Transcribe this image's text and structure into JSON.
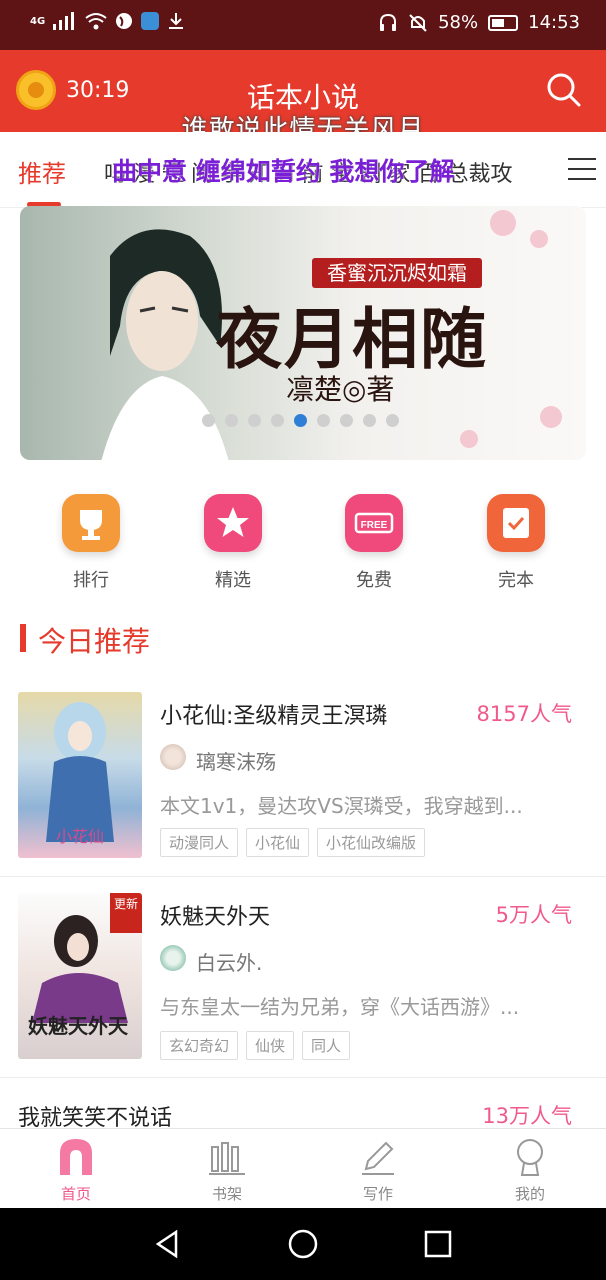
{
  "status_bar": {
    "network": "4G",
    "battery": "58%",
    "time": "14:53"
  },
  "header": {
    "timer": "30:19",
    "title": "话本小说",
    "overlay_subtitle": "谁敢说此情无关风月"
  },
  "tabs": {
    "active": "推荐",
    "row_text": "吗 漫 短 阅 学 知 H 前 宝 剧 家 百 总裁攻",
    "overlay_text": "曲中意 缠绵如誓约 我想你了解"
  },
  "banner": {
    "tagline": "香蜜沉沉烬如霜",
    "title": "夜月相随",
    "author": "凛楚◎著",
    "dot_count": 9,
    "active_dot": 5
  },
  "quick_links": [
    {
      "label": "排行",
      "icon": "trophy-icon",
      "color": "#f59a3a"
    },
    {
      "label": "精选",
      "icon": "star-icon",
      "color": "#f04a7c"
    },
    {
      "label": "免费",
      "icon": "free-icon",
      "color": "#f04a7c"
    },
    {
      "label": "完本",
      "icon": "check-icon",
      "color": "#f0663a"
    }
  ],
  "section": {
    "title": "今日推荐"
  },
  "books": [
    {
      "title": "小花仙:圣级精灵王溟璘",
      "popularity": "8157人气",
      "author": "璃寒沫殇",
      "blurb": "本文1v1，曼达攻VS溟璘受，我穿越到...",
      "tags": [
        "动漫同人",
        "小花仙",
        "小花仙改编版"
      ]
    },
    {
      "title": "妖魅天外天",
      "popularity": "5万人气",
      "author": "白云外.",
      "blurb": "与东皇太一结为兄弟，穿《大话西游》...",
      "tags": [
        "玄幻奇幻",
        "仙侠",
        "同人"
      ],
      "badge": "更新"
    },
    {
      "title": "我就笑笑不说话",
      "popularity": "13万人气"
    }
  ],
  "bottom_nav": [
    {
      "label": "首页",
      "icon": "home-icon",
      "active": true
    },
    {
      "label": "书架",
      "icon": "bookshelf-icon",
      "active": false
    },
    {
      "label": "写作",
      "icon": "pencil-icon",
      "active": false
    },
    {
      "label": "我的",
      "icon": "profile-icon",
      "active": false
    }
  ],
  "colors": {
    "brand_red": "#e53a2c",
    "status_bar": "#5e1414",
    "popularity_pink": "#f05a8a",
    "overlay_purple": "#7a1fd6"
  }
}
